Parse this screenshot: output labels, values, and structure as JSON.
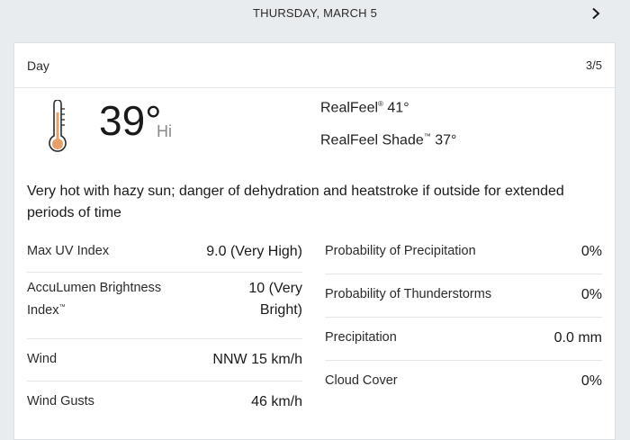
{
  "nav": {
    "date": "THURSDAY, MARCH 5"
  },
  "card": {
    "title": "Day",
    "page": "3/5",
    "temperature": "39°",
    "temperature_label": "Hi",
    "realfeel": {
      "label": "RealFeel",
      "mark": "®",
      "value": "41°"
    },
    "realfeel_shade": {
      "label": "RealFeel Shade",
      "mark": "™",
      "value": "37°"
    },
    "description": "Very hot with hazy sun; danger of dehydration and heatstroke if outside for extended periods of time",
    "details_left": [
      {
        "label": "Max UV Index",
        "value": "9.0 (Very High)"
      },
      {
        "label": "AccuLumen Brightness Index",
        "mark": "™",
        "value": "10 (Very Bright)"
      },
      {
        "label": "Wind",
        "value": "NNW 15 km/h"
      },
      {
        "label": "Wind Gusts",
        "value": "46 km/h"
      }
    ],
    "details_right": [
      {
        "label": "Probability of Precipitation",
        "value": "0%"
      },
      {
        "label": "Probability of Thunderstorms",
        "value": "0%"
      },
      {
        "label": "Precipitation",
        "value": "0.0 mm"
      },
      {
        "label": "Cloud Cover",
        "value": "0%"
      }
    ]
  },
  "icons": {
    "next": "chevron-right-icon",
    "thermometer": "thermometer-icon"
  },
  "colors": {
    "background": "#e9ecef",
    "card": "#ffffff",
    "thermometer": "#e8a06a"
  }
}
